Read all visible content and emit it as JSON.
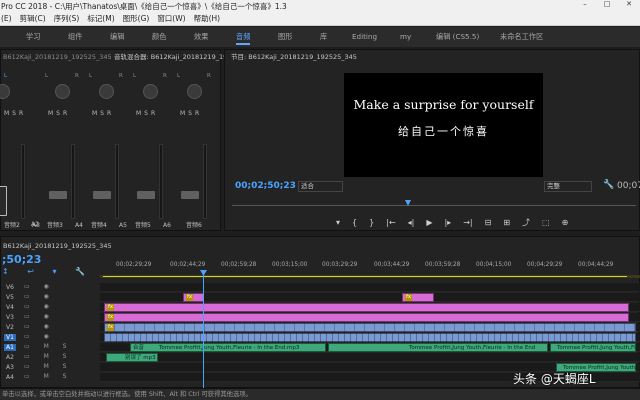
{
  "window": {
    "title": "Pro CC 2018 - C:\\用户\\Thanatos\\桌面\\《给自己一个惊喜》\\《给自己一个惊喜》1.3",
    "min": "–",
    "max": "□",
    "close": "✕"
  },
  "menu": [
    "(E)",
    "剪辑(C)",
    "序列(S)",
    "标记(M)",
    "图形(G)",
    "窗口(W)",
    "帮助(H)"
  ],
  "workspaces": [
    "学习",
    "组件",
    "编辑",
    "颜色",
    "效果",
    "音频",
    "图形",
    "库",
    "Editing",
    "my",
    "编辑 (CS5.5)",
    "未命名工作区"
  ],
  "mixer": {
    "tabs": [
      "B612Kaji_20181219_192525_345",
      "音轨混合器: B612Kaji_20181219_192525_345"
    ],
    "lr": [
      "L",
      "R"
    ],
    "msr": "MSR",
    "channels": [
      {
        "label": "音频2",
        "track": "A3"
      },
      {
        "label": "音频3",
        "track": "A4"
      },
      {
        "label": "音频4",
        "track": "A5"
      },
      {
        "label": "音频5",
        "track": "A6"
      },
      {
        "label": "音频6",
        "track": ""
      }
    ],
    "first_track": "A2"
  },
  "program": {
    "tab": "节目: B612Kaji_20181219_192525_345",
    "line1": "Make a surprise for yourself",
    "line2": "给自己一个惊喜",
    "timecode": "00;02;50;23",
    "fit": "适合",
    "quality": "完整",
    "end_timecode": "00;07;"
  },
  "transport": [
    "▾",
    "{",
    "}",
    "|←",
    "◂|",
    "▶",
    "|▸",
    "→|",
    "⊟",
    "⊞",
    "⤴",
    "⬚",
    "⊕"
  ],
  "timeline": {
    "tab": "B612Kaji_20181219_192525_345",
    "timecode": ";50;23",
    "ruler": [
      "00;02;29;29",
      "00;02;44;29",
      "00;02;59;28",
      "00;03;15;00",
      "00;03;29;29",
      "00;03;44;29",
      "00;03;59;28",
      "00;04;15;00",
      "00;04;29;29",
      "00;04;44;29"
    ],
    "tracks": [
      "V6",
      "V5",
      "V4",
      "V3",
      "V2",
      "V1",
      "A1",
      "A2",
      "A3",
      "A4"
    ],
    "clip_labels": [
      "Tommee Profitt,Jung Youth,Fleurie - In the End.mp3",
      "Tommee Profitt,Jung Youth,Fleurie - In the End",
      "Tommee Profitt,Jung Youth,Fleu",
      "别误了 mp3",
      "合音",
      "fx"
    ],
    "colors": {
      "pink": "#d96bd6",
      "blue": "#7a9ad1",
      "green": "#3ea97b",
      "accent": "#4aa3ff"
    }
  },
  "status": "单击以选择，或单击空白处并拖动以进行框选。使用 Shift、Alt 和 Ctrl 可获得其他选项。",
  "watermark": "头条 @天蝎座L"
}
